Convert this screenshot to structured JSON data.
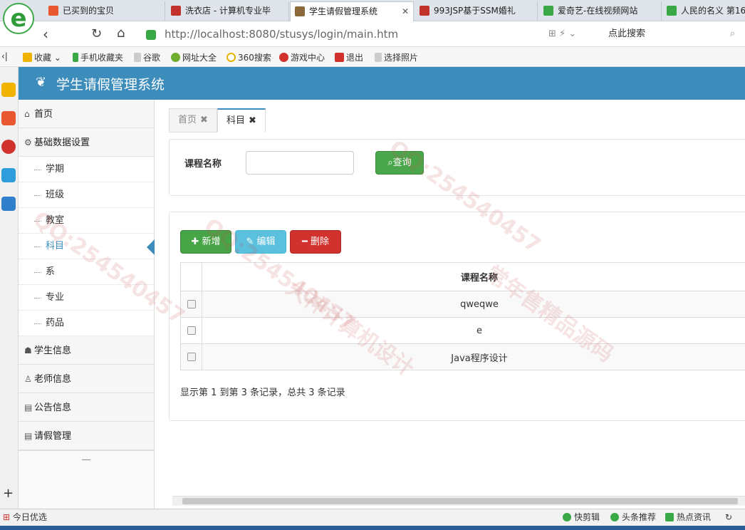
{
  "browser": {
    "tabs": [
      {
        "label": "已买到的宝贝",
        "color": "#e8572f"
      },
      {
        "label": "洗衣店 - 计算机专业毕",
        "color": "#c0322b"
      },
      {
        "label": "学生请假管理系统",
        "color": "#8a6a3a"
      },
      {
        "label": "993JSP基于SSM婚礼",
        "color": "#c0322b"
      },
      {
        "label": "爱奇艺-在线视频网站",
        "color": "#3aa846"
      },
      {
        "label": "人民的名义 第16",
        "color": "#3aa846"
      }
    ],
    "active_tab_index": 2,
    "url": "http://localhost:8080/stusys/login/main.htm",
    "search_placeholder": "点此搜索",
    "bookmarks": [
      {
        "label": "收藏",
        "color": "#f0b400"
      },
      {
        "label": "手机收藏夹",
        "color": "#3aa846"
      },
      {
        "label": "谷歌",
        "color": "#bbbbbb"
      },
      {
        "label": "网址大全",
        "color": "#6fae2f"
      },
      {
        "label": "360搜索",
        "color": "#2f9cdb"
      },
      {
        "label": "游戏中心",
        "color": "#d2322d"
      },
      {
        "label": "退出",
        "color": "#d2322d"
      },
      {
        "label": "选择照片",
        "color": "#bbbbbb"
      }
    ]
  },
  "app": {
    "title": "学生请假管理系统",
    "header_color": "#3c8dbc",
    "sidebar": {
      "sections": [
        {
          "icon": "home-icon",
          "glyph": "⌂",
          "label": "首页"
        },
        {
          "icon": "gear-icon",
          "glyph": "⚙",
          "label": "基础数据设置",
          "items": [
            "学期",
            "班级",
            "教室",
            "科目",
            "系",
            "专业",
            "药品"
          ]
        },
        {
          "icon": "users-icon",
          "glyph": "☗",
          "label": "学生信息"
        },
        {
          "icon": "user-icon",
          "glyph": "♙",
          "label": "老师信息"
        },
        {
          "icon": "file-icon",
          "glyph": "▤",
          "label": "公告信息"
        },
        {
          "icon": "file-icon",
          "glyph": "▤",
          "label": "请假管理"
        }
      ],
      "selected_item": "科目",
      "collapse_glyph": "—"
    },
    "page_tabs": [
      {
        "label": "首页",
        "close": "✖"
      },
      {
        "label": "科目",
        "close": "✖"
      }
    ],
    "search": {
      "label": "课程名称",
      "value": "",
      "button": "查询"
    },
    "toolbar": {
      "add": "新增",
      "edit": "编辑",
      "delete": "删除"
    },
    "table": {
      "columns": [
        "课程名称"
      ],
      "rows": [
        "qweqwe",
        "e",
        "Java程序设计"
      ]
    },
    "pagination_text": "显示第 1 到第 3 条记录，总共 3 条记录"
  },
  "statusbar": {
    "left": "今日优选",
    "items": [
      "快剪辑",
      "头条推荐",
      "热点资讯"
    ]
  },
  "watermarks": [
    "QQ:254540457",
    "大神计算机设计",
    "常年售精品源码"
  ]
}
